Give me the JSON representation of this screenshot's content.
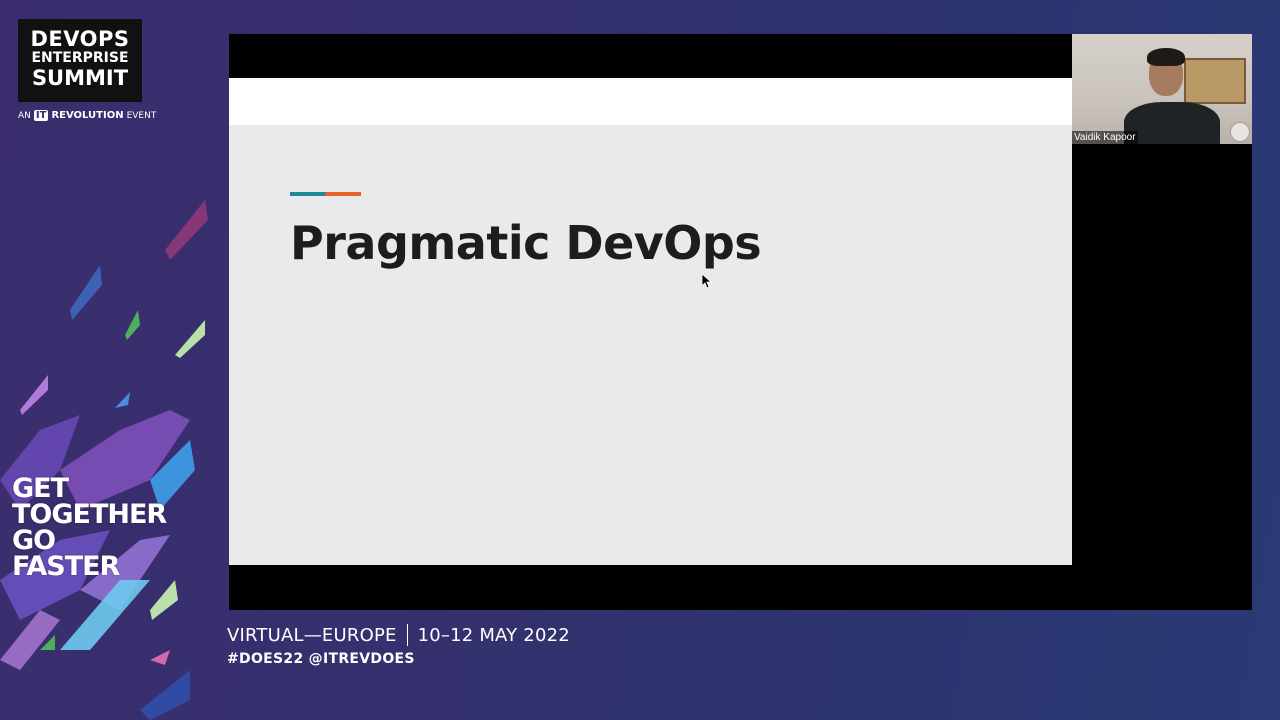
{
  "branding": {
    "logo_line1": "DEVOPS",
    "logo_line2": "ENTERPRISE",
    "logo_line3": "SUMMIT",
    "sub_prefix": "AN",
    "sub_mark": "IT",
    "sub_brand": "REVOLUTION",
    "sub_suffix": "EVENT"
  },
  "tagline": [
    "GET",
    "TOGETHER",
    "GO",
    "FASTER"
  ],
  "slide": {
    "title": "Pragmatic DevOps",
    "accent_colors": [
      "#1f8a9a",
      "#e8622a"
    ]
  },
  "webcam": {
    "speaker_name": "Vaidik Kapoor"
  },
  "footer": {
    "event": "VIRTUAL—EUROPE",
    "dates": "10–12 MAY 2022",
    "hashtags": "#DOES22 @ITREVDOES"
  }
}
